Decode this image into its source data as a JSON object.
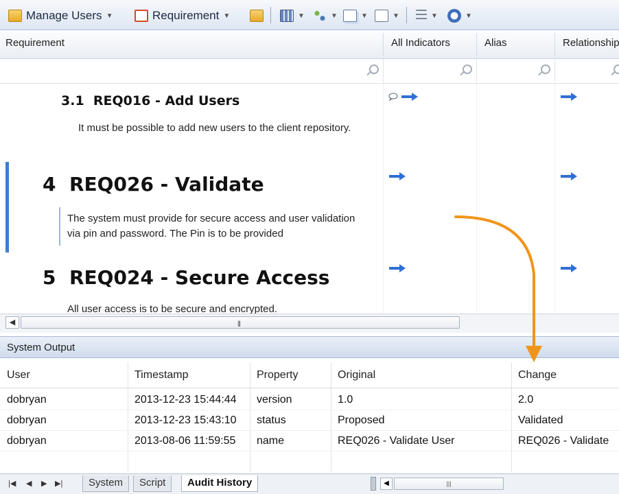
{
  "toolbar": {
    "manage_users": "Manage Users",
    "requirement": "Requirement"
  },
  "grid": {
    "columns": [
      "Requirement",
      "All Indicators",
      "Alias",
      "Relationship"
    ]
  },
  "doc": {
    "items": [
      {
        "number": "3.1",
        "title": "REQ016 - Add Users",
        "body": "It must be possible to add new users to the client repository."
      },
      {
        "number": "4",
        "title": "REQ026 - Validate",
        "body": "The system must provide for secure access and user validation via pin and password. The Pin is to be provided"
      },
      {
        "number": "5",
        "title": "REQ024 - Secure Access",
        "body": "All user access is to be secure and encrypted."
      }
    ]
  },
  "output": {
    "title": "System Output",
    "columns": [
      "User",
      "Timestamp",
      "Property",
      "Original",
      "Change"
    ],
    "rows": [
      [
        "dobryan",
        "2013-12-23 15:44:44",
        "version",
        "1.0",
        "2.0"
      ],
      [
        "dobryan",
        "2013-12-23 15:43:10",
        "status",
        "Proposed",
        "Validated"
      ],
      [
        "dobryan",
        "2013-08-06 11:59:55",
        "name",
        "REQ026 - Validate User",
        "REQ026 - Validate"
      ]
    ]
  },
  "tabs": [
    "System",
    "Script",
    "Audit History"
  ],
  "colors": {
    "accent": "#3a7fd0",
    "callout_arrow": "#f0951c",
    "link_arrow": "#2f6fd6"
  }
}
